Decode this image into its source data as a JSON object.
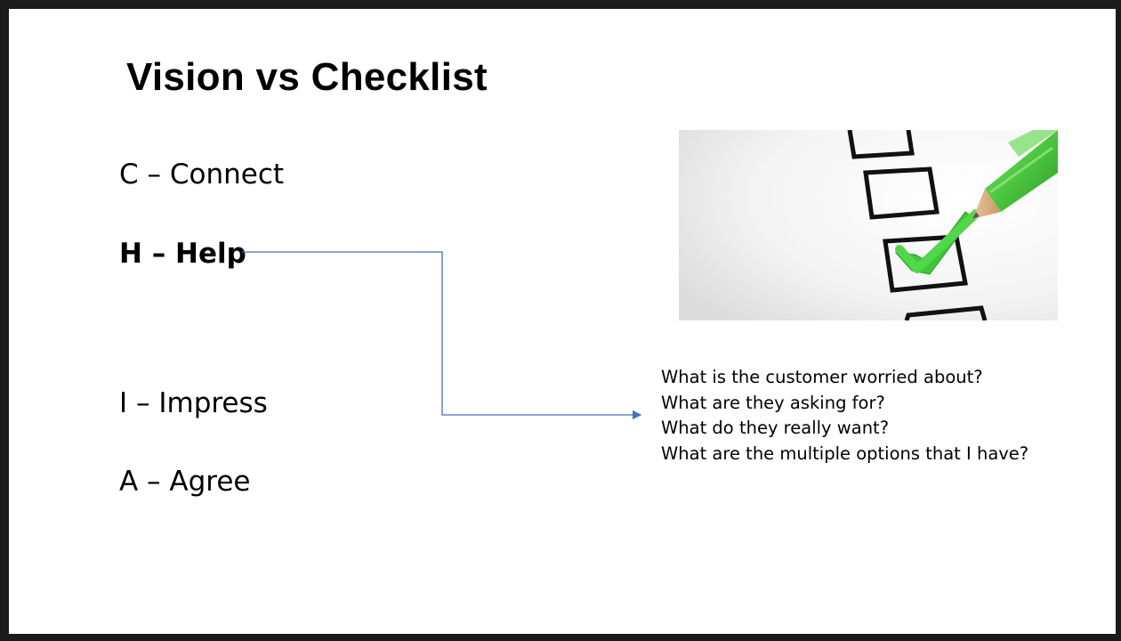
{
  "slide": {
    "title": "Vision vs Checklist",
    "chia": [
      {
        "text": "C – Connect",
        "bold": false
      },
      {
        "text": "H – Help",
        "bold": true
      },
      {
        "text": "I – Impress",
        "bold": false
      },
      {
        "text": "A – Agree",
        "bold": false
      }
    ],
    "questions": [
      "What is the customer worried about?",
      "What are they asking for?",
      "What do they really want?",
      "What are the multiple options that I have?"
    ],
    "connector_color": "#4472C4",
    "image": {
      "icon": "checklist-pencil-icon",
      "checkbox_color": "#111111",
      "check_color": "#3FC63A",
      "pencil_color": "#4CC63F"
    }
  }
}
